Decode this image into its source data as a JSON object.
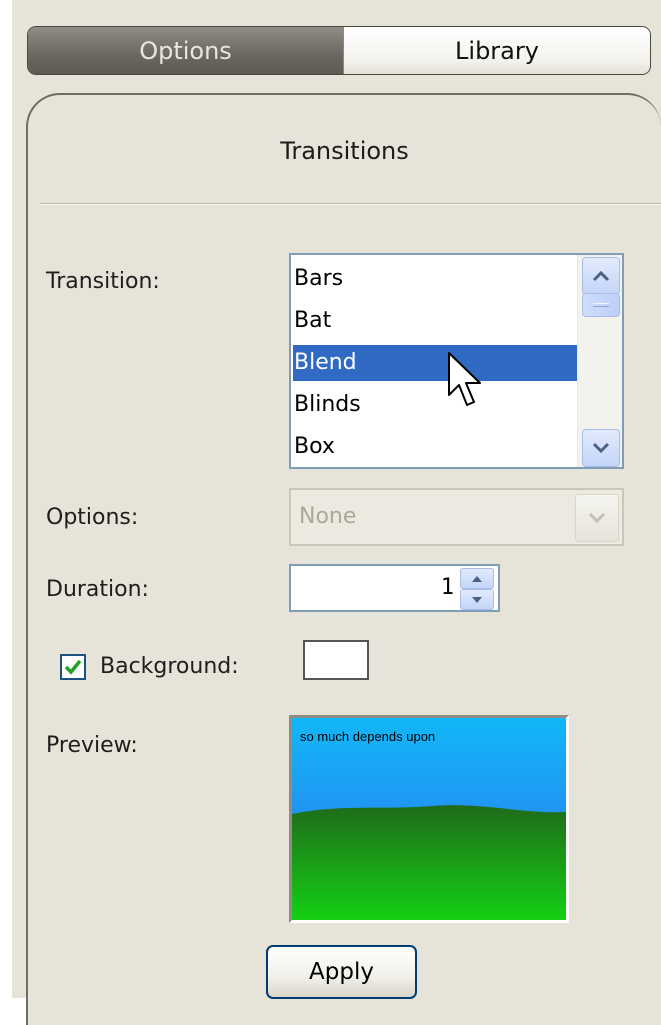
{
  "tabs": [
    {
      "label": "Options",
      "active": true
    },
    {
      "label": "Library",
      "active": false
    }
  ],
  "panel": {
    "title": "Transitions"
  },
  "transition": {
    "label": "Transition:",
    "items": [
      "Bars",
      "Bat",
      "Blend",
      "Blinds",
      "Box"
    ],
    "selected": "Blend",
    "scroll_up_icon": "chevron-up-icon",
    "scroll_down_icon": "chevron-down-icon"
  },
  "options": {
    "label": "Options:",
    "value": "None",
    "disabled": true
  },
  "duration": {
    "label": "Duration:",
    "value": "1"
  },
  "background": {
    "label": "Background:",
    "checked": true,
    "color": "#ffffff"
  },
  "preview": {
    "label": "Preview:",
    "text": "so much depends upon"
  },
  "apply_label": "Apply",
  "colors": {
    "panel_bg": "#e6e3d8",
    "selection": "#316ac5",
    "checkmark": "#21a121",
    "sky": "#1a8cf5",
    "grass": "#1d9b18"
  }
}
